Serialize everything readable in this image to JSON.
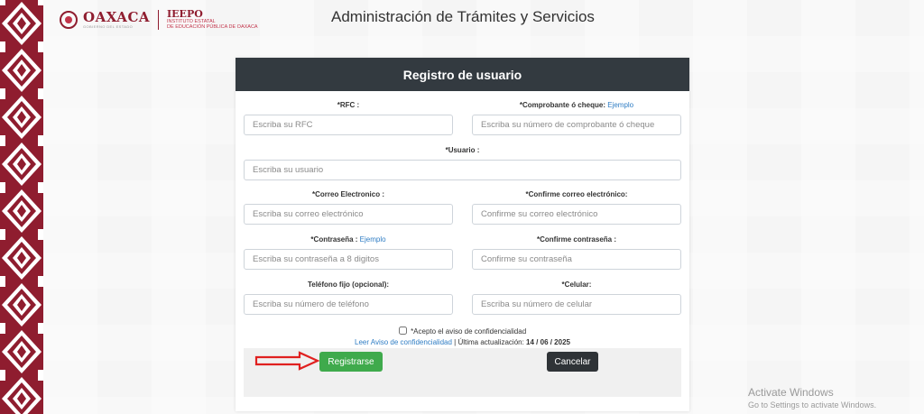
{
  "header": {
    "logo_main": "OAXACA",
    "logo_tagline": "GOBIERNO DEL ESTADO",
    "logo_secondary": "IEEPO",
    "logo_secondary_line1": "INSTITUTO ESTATAL",
    "logo_secondary_line2": "DE EDUCACIÓN PÚBLICA DE OAXACA",
    "title": "Administración de Trámites y Servicios"
  },
  "form": {
    "title": "Registro de usuario",
    "rfc": {
      "label": "*RFC :",
      "placeholder": "Escriba su RFC"
    },
    "comprobante": {
      "label": "*Comprobante ó cheque:",
      "link": "Ejemplo",
      "placeholder": "Escriba su número de comprobante ó cheque"
    },
    "usuario": {
      "label": "*Usuario :",
      "placeholder": "Escriba su usuario"
    },
    "correo": {
      "label": "*Correo Electronico :",
      "placeholder": "Escriba su correo electrónico"
    },
    "confirm_correo": {
      "label": "*Confirme correo electrónico:",
      "placeholder": "Confirme su correo electrónico"
    },
    "contrasena": {
      "label": "*Contraseña :",
      "link": "Ejemplo",
      "placeholder": "Escriba su contraseña a 8 digitos"
    },
    "confirm_contrasena": {
      "label": "*Confirme contraseña :",
      "placeholder": "Confirme su contraseña"
    },
    "telefono": {
      "label": "Teléfono fijo (opcional):",
      "placeholder": "Escriba su número de teléfono"
    },
    "celular": {
      "label": "*Celular:",
      "placeholder": "Escriba su número de celular"
    },
    "consent_label": "*Acepto el aviso de confidencialidad",
    "privacy_link": "Leer Aviso de confidencialidad",
    "privacy_separator": " | Última actualización: ",
    "privacy_date": "14 / 06 / 2025",
    "register_label": "Registrarse",
    "cancel_label": "Cancelar"
  },
  "watermark": {
    "line1": "Activate Windows",
    "line2": "Go to Settings to activate Windows."
  },
  "colors": {
    "brand": "#8f1d2f",
    "header_bar": "#333a40",
    "register": "#3faa4c",
    "cancel": "#2f3337",
    "link": "#2f7dc4",
    "arrow": "#e0201f"
  }
}
